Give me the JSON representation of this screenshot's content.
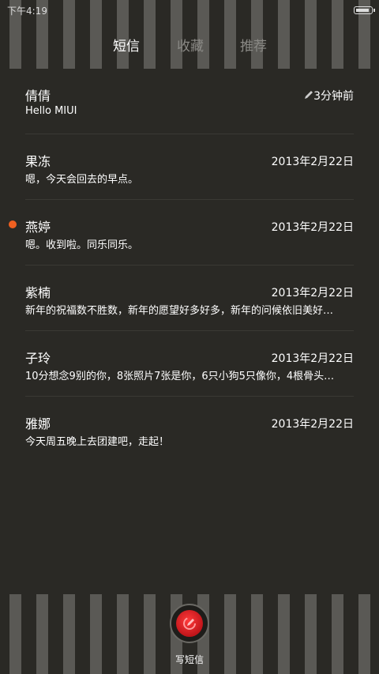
{
  "status_bar": {
    "time": "下午4:19"
  },
  "tabs": [
    {
      "label": "短信",
      "active": true
    },
    {
      "label": "收藏",
      "active": false
    },
    {
      "label": "推荐",
      "active": false
    }
  ],
  "conversations": [
    {
      "name": "倩倩",
      "date": "3分钟前",
      "preview": "Hello MIUI",
      "draft": true,
      "unread": false
    },
    {
      "name": "果冻",
      "date": "2013年2月22日",
      "preview": "嗯，今天会回去的早点。",
      "draft": false,
      "unread": false
    },
    {
      "name": "燕婷",
      "date": "2013年2月22日",
      "preview": "嗯。收到啦。同乐同乐。",
      "draft": false,
      "unread": true
    },
    {
      "name": "紫楠",
      "date": "2013年2月22日",
      "preview": "新年的祝福数不胜数，新年的愿望好多好多，新年的问候依旧美好…",
      "draft": false,
      "unread": false
    },
    {
      "name": "子玲",
      "date": "2013年2月22日",
      "preview": "10分想念9别的你，8张照片7张是你，6只小狗5只像你，4根骨头…",
      "draft": false,
      "unread": false
    },
    {
      "name": "雅娜",
      "date": "2013年2月22日",
      "preview": "今天周五晚上去团建吧，走起！",
      "draft": false,
      "unread": false
    }
  ],
  "compose": {
    "label": "写短信"
  },
  "colors": {
    "background": "#2a2925",
    "stripe": "#5a5955",
    "unread_dot": "#f06020",
    "compose_button": "#e0201f"
  }
}
